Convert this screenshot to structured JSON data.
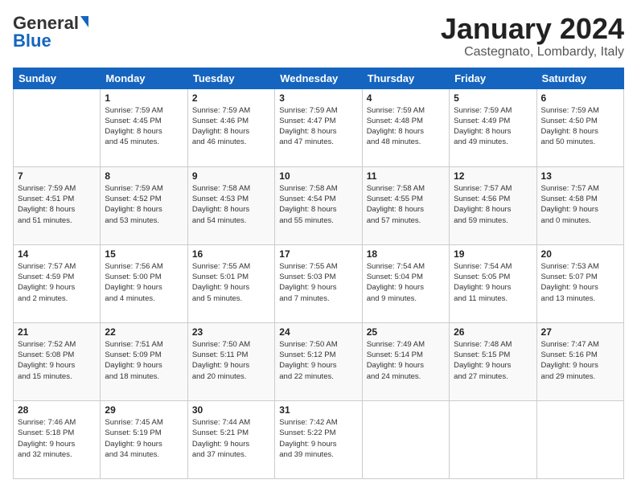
{
  "header": {
    "logo_general": "General",
    "logo_blue": "Blue",
    "month_title": "January 2024",
    "location": "Castegnato, Lombardy, Italy"
  },
  "calendar": {
    "headers": [
      "Sunday",
      "Monday",
      "Tuesday",
      "Wednesday",
      "Thursday",
      "Friday",
      "Saturday"
    ],
    "rows": [
      [
        {
          "day": "",
          "info": ""
        },
        {
          "day": "1",
          "info": "Sunrise: 7:59 AM\nSunset: 4:45 PM\nDaylight: 8 hours\nand 45 minutes."
        },
        {
          "day": "2",
          "info": "Sunrise: 7:59 AM\nSunset: 4:46 PM\nDaylight: 8 hours\nand 46 minutes."
        },
        {
          "day": "3",
          "info": "Sunrise: 7:59 AM\nSunset: 4:47 PM\nDaylight: 8 hours\nand 47 minutes."
        },
        {
          "day": "4",
          "info": "Sunrise: 7:59 AM\nSunset: 4:48 PM\nDaylight: 8 hours\nand 48 minutes."
        },
        {
          "day": "5",
          "info": "Sunrise: 7:59 AM\nSunset: 4:49 PM\nDaylight: 8 hours\nand 49 minutes."
        },
        {
          "day": "6",
          "info": "Sunrise: 7:59 AM\nSunset: 4:50 PM\nDaylight: 8 hours\nand 50 minutes."
        }
      ],
      [
        {
          "day": "7",
          "info": "Sunrise: 7:59 AM\nSunset: 4:51 PM\nDaylight: 8 hours\nand 51 minutes."
        },
        {
          "day": "8",
          "info": "Sunrise: 7:59 AM\nSunset: 4:52 PM\nDaylight: 8 hours\nand 53 minutes."
        },
        {
          "day": "9",
          "info": "Sunrise: 7:58 AM\nSunset: 4:53 PM\nDaylight: 8 hours\nand 54 minutes."
        },
        {
          "day": "10",
          "info": "Sunrise: 7:58 AM\nSunset: 4:54 PM\nDaylight: 8 hours\nand 55 minutes."
        },
        {
          "day": "11",
          "info": "Sunrise: 7:58 AM\nSunset: 4:55 PM\nDaylight: 8 hours\nand 57 minutes."
        },
        {
          "day": "12",
          "info": "Sunrise: 7:57 AM\nSunset: 4:56 PM\nDaylight: 8 hours\nand 59 minutes."
        },
        {
          "day": "13",
          "info": "Sunrise: 7:57 AM\nSunset: 4:58 PM\nDaylight: 9 hours\nand 0 minutes."
        }
      ],
      [
        {
          "day": "14",
          "info": "Sunrise: 7:57 AM\nSunset: 4:59 PM\nDaylight: 9 hours\nand 2 minutes."
        },
        {
          "day": "15",
          "info": "Sunrise: 7:56 AM\nSunset: 5:00 PM\nDaylight: 9 hours\nand 4 minutes."
        },
        {
          "day": "16",
          "info": "Sunrise: 7:55 AM\nSunset: 5:01 PM\nDaylight: 9 hours\nand 5 minutes."
        },
        {
          "day": "17",
          "info": "Sunrise: 7:55 AM\nSunset: 5:03 PM\nDaylight: 9 hours\nand 7 minutes."
        },
        {
          "day": "18",
          "info": "Sunrise: 7:54 AM\nSunset: 5:04 PM\nDaylight: 9 hours\nand 9 minutes."
        },
        {
          "day": "19",
          "info": "Sunrise: 7:54 AM\nSunset: 5:05 PM\nDaylight: 9 hours\nand 11 minutes."
        },
        {
          "day": "20",
          "info": "Sunrise: 7:53 AM\nSunset: 5:07 PM\nDaylight: 9 hours\nand 13 minutes."
        }
      ],
      [
        {
          "day": "21",
          "info": "Sunrise: 7:52 AM\nSunset: 5:08 PM\nDaylight: 9 hours\nand 15 minutes."
        },
        {
          "day": "22",
          "info": "Sunrise: 7:51 AM\nSunset: 5:09 PM\nDaylight: 9 hours\nand 18 minutes."
        },
        {
          "day": "23",
          "info": "Sunrise: 7:50 AM\nSunset: 5:11 PM\nDaylight: 9 hours\nand 20 minutes."
        },
        {
          "day": "24",
          "info": "Sunrise: 7:50 AM\nSunset: 5:12 PM\nDaylight: 9 hours\nand 22 minutes."
        },
        {
          "day": "25",
          "info": "Sunrise: 7:49 AM\nSunset: 5:14 PM\nDaylight: 9 hours\nand 24 minutes."
        },
        {
          "day": "26",
          "info": "Sunrise: 7:48 AM\nSunset: 5:15 PM\nDaylight: 9 hours\nand 27 minutes."
        },
        {
          "day": "27",
          "info": "Sunrise: 7:47 AM\nSunset: 5:16 PM\nDaylight: 9 hours\nand 29 minutes."
        }
      ],
      [
        {
          "day": "28",
          "info": "Sunrise: 7:46 AM\nSunset: 5:18 PM\nDaylight: 9 hours\nand 32 minutes."
        },
        {
          "day": "29",
          "info": "Sunrise: 7:45 AM\nSunset: 5:19 PM\nDaylight: 9 hours\nand 34 minutes."
        },
        {
          "day": "30",
          "info": "Sunrise: 7:44 AM\nSunset: 5:21 PM\nDaylight: 9 hours\nand 37 minutes."
        },
        {
          "day": "31",
          "info": "Sunrise: 7:42 AM\nSunset: 5:22 PM\nDaylight: 9 hours\nand 39 minutes."
        },
        {
          "day": "",
          "info": ""
        },
        {
          "day": "",
          "info": ""
        },
        {
          "day": "",
          "info": ""
        }
      ]
    ]
  }
}
